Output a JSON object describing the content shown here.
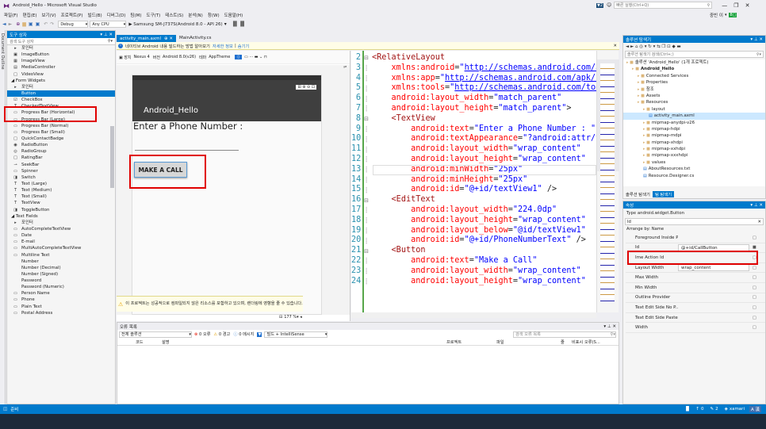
{
  "window": {
    "title": "Android_Hello - Microsoft Visual Studio",
    "quick_launch": "빠른 실행(Ctrl+Q)",
    "user": "중빈 이",
    "badge": "2"
  },
  "menu": [
    "파일(F)",
    "편집(E)",
    "보기(V)",
    "프로젝트(P)",
    "빌드(B)",
    "디버그(D)",
    "팀(M)",
    "도구(T)",
    "테스트(S)",
    "분석(N)",
    "창(W)",
    "도움말(H)"
  ],
  "toolbar": {
    "config": "Debug",
    "platform": "Any CPU",
    "device": "▶ Samsung SM-J737S(Android 8.0 - API 26)"
  },
  "toolbox": {
    "title": "도구 상자",
    "search_placeholder": "검색 도구 상자",
    "items": [
      {
        "label": "포인터",
        "icon": "▸"
      },
      {
        "label": "ImageButton",
        "icon": "▣"
      },
      {
        "label": "ImageView",
        "icon": "▦"
      },
      {
        "label": "MediaController",
        "icon": "▤"
      },
      {
        "label": "VideoView",
        "icon": "□"
      },
      {
        "label": "◢ Form Widgets",
        "icon": "",
        "group": true
      },
      {
        "label": "포인터",
        "icon": "▸"
      },
      {
        "label": "Button",
        "icon": "",
        "selected": true
      },
      {
        "label": "CheckBox",
        "icon": "☑"
      },
      {
        "label": "CheckedTextView",
        "icon": "T"
      },
      {
        "label": "Progress Bar (Horizontal)",
        "icon": "▭"
      },
      {
        "label": "Progress Bar (Large)",
        "icon": "▭"
      },
      {
        "label": "Progress Bar (Normal)",
        "icon": "▭"
      },
      {
        "label": "Progress Bar (Small)",
        "icon": "▭"
      },
      {
        "label": "QuickContactBadge",
        "icon": "□"
      },
      {
        "label": "RadioButton",
        "icon": "◉"
      },
      {
        "label": "RadioGroup",
        "icon": "◎"
      },
      {
        "label": "RatingBar",
        "icon": "□"
      },
      {
        "label": "SeekBar",
        "icon": "⊸"
      },
      {
        "label": "Spinner",
        "icon": "▭"
      },
      {
        "label": "Switch",
        "icon": "◨"
      },
      {
        "label": "Text (Large)",
        "icon": "T"
      },
      {
        "label": "Text (Medium)",
        "icon": "T"
      },
      {
        "label": "Text (Small)",
        "icon": "T"
      },
      {
        "label": "TextView",
        "icon": "T"
      },
      {
        "label": "ToggleButton",
        "icon": "◨"
      },
      {
        "label": "◢ Text Fields",
        "icon": "",
        "group": true
      },
      {
        "label": "포인터",
        "icon": "▸"
      },
      {
        "label": "AutoCompleteTextView",
        "icon": "▭"
      },
      {
        "label": "Date",
        "icon": "▭"
      },
      {
        "label": "E-mail",
        "icon": "▭"
      },
      {
        "label": "MultiAutoCompleteTextView",
        "icon": "▭"
      },
      {
        "label": "Multiline Text",
        "icon": "▭"
      },
      {
        "label": "Number",
        "icon": ""
      },
      {
        "label": "Number (Decimal)",
        "icon": ""
      },
      {
        "label": "Number (Signed)",
        "icon": ""
      },
      {
        "label": "Password",
        "icon": ""
      },
      {
        "label": "Password (Numeric)",
        "icon": ""
      },
      {
        "label": "Person Name",
        "icon": "▭"
      },
      {
        "label": "Phone",
        "icon": "▭"
      },
      {
        "label": "Plain Text",
        "icon": "▭"
      },
      {
        "label": "Postal Address",
        "icon": "▭"
      }
    ]
  },
  "tabs": [
    "activity_main.axml",
    "MainActivity.cs"
  ],
  "infobar": "네이티브 Android 내용 빌드하는 방법 알아보기",
  "infobar_link1": "자세한 정보",
  "infobar_link2": "숨기기",
  "designer": {
    "device": "Nexus 4",
    "version": "Android 8.0(v26)",
    "theme": "AppTheme",
    "app_title": "Android_Hello",
    "text_view": "Enter a Phone Number :",
    "button": "MAKE A CALL",
    "zoom": "177 %",
    "warning": "이 프로젝트는 성공적으로 컴파일되지 않은 리소스를 포함하고 있으며, 렌더링에 영향을 줄 수 있습니다."
  },
  "code_lines": [
    {
      "n": "2",
      "html": "<span class='tag'>&lt;RelativeLayout</span>"
    },
    {
      "n": "3",
      "html": "    <span class='a'>xmlns:android</span>=<span class='v'>\"</span><span class='u'>http://schemas.android.com/apk</span>"
    },
    {
      "n": "4",
      "html": "    <span class='a'>xmlns:app</span>=<span class='v'>\"</span><span class='u'>http://schemas.android.com/apk/res</span>"
    },
    {
      "n": "5",
      "html": "    <span class='a'>xmlns:tools</span>=<span class='v'>\"</span><span class='u'>http://schemas.android.com/tools</span>"
    },
    {
      "n": "6",
      "html": "    <span class='a'>android:layout_width</span>=<span class='v'>\"match_parent\"</span>"
    },
    {
      "n": "7",
      "html": "    <span class='a'>android:layout_height</span>=<span class='v'>\"match_parent\"</span>&gt;"
    },
    {
      "n": "8",
      "html": "    <span class='tag'>&lt;TextView</span>"
    },
    {
      "n": "9",
      "html": "        <span class='a'>android:text</span>=<span class='v'>\"Enter a Phone Number : \"</span>"
    },
    {
      "n": "10",
      "html": "        <span class='a'>android:textAppearance</span>=<span class='v'>\"?android:attr/tex</span>"
    },
    {
      "n": "11",
      "html": "        <span class='a'>android:layout_width</span>=<span class='v'>\"wrap_content\"</span>"
    },
    {
      "n": "12",
      "html": "        <span class='a'>android:layout_height</span>=<span class='v'>\"wrap_content\"</span>"
    },
    {
      "n": "13",
      "html": "        <span class='a'>android:minWidth</span>=<span class='v'>\"25px\"</span>"
    },
    {
      "n": "14",
      "html": "        <span class='a'>android:minHeight</span>=<span class='v'>\"25px\"</span>"
    },
    {
      "n": "15",
      "html": "        <span class='a'>android:id</span>=<span class='v'>\"@+id/textView1\"</span> /&gt;"
    },
    {
      "n": "16",
      "html": "    <span class='tag'>&lt;EditText</span>"
    },
    {
      "n": "17",
      "html": "        <span class='a'>android:layout_width</span>=<span class='v'>\"224.0dp\"</span>"
    },
    {
      "n": "18",
      "html": "        <span class='a'>android:layout_height</span>=<span class='v'>\"wrap_content\"</span>"
    },
    {
      "n": "19",
      "html": "        <span class='a'>android:layout_below</span>=<span class='v'>\"@id/textView1\"</span>"
    },
    {
      "n": "20",
      "html": "        <span class='a'>android:id</span>=<span class='v'>\"@+id/PhoneNumberText\"</span> /&gt;"
    },
    {
      "n": "21",
      "html": "    <span class='tag'>&lt;Button</span>"
    },
    {
      "n": "22",
      "html": "        <span class='a'>android:text</span>=<span class='v'>\"Make a Call\"</span>"
    },
    {
      "n": "23",
      "html": "        <span class='a'>android:layout_width</span>=<span class='v'>\"wrap_content\"</span>"
    },
    {
      "n": "24",
      "html": "        <span class='a'>android:layout_height</span>=<span class='v'>\"wrap_content\"</span>"
    }
  ],
  "errors": {
    "title": "오류 목록",
    "scope": "전체 솔루션",
    "err": "0 오류",
    "warn": "0 경고",
    "msg": "0 메시지",
    "build": "빌드 + IntelliSense",
    "search": "검색 오류 목록",
    "cols": [
      "코드",
      "설명",
      "프로젝트",
      "파일",
      "줄",
      "비표시 오류(S..."
    ]
  },
  "solution": {
    "title": "솔루션 탐색기",
    "search": "솔루션 탐색기 검색(Ctrl+;)",
    "items": [
      {
        "label": "솔루션 'Android_Hello' (1개 프로젝트)",
        "indent": 0
      },
      {
        "label": "Android_Hello",
        "indent": 1,
        "bold": true
      },
      {
        "label": "Connected Services",
        "indent": 2
      },
      {
        "label": "Properties",
        "indent": 2
      },
      {
        "label": "참조",
        "indent": 2
      },
      {
        "label": "Assets",
        "indent": 2
      },
      {
        "label": "Resources",
        "indent": 2
      },
      {
        "label": "layout",
        "indent": 3
      },
      {
        "label": "activity_main.axml",
        "indent": 4,
        "selected": true
      },
      {
        "label": "mipmap-anydpi-v26",
        "indent": 3
      },
      {
        "label": "mipmap-hdpi",
        "indent": 3
      },
      {
        "label": "mipmap-mdpi",
        "indent": 3
      },
      {
        "label": "mipmap-xhdpi",
        "indent": 3
      },
      {
        "label": "mipmap-xxhdpi",
        "indent": 3
      },
      {
        "label": "mipmap-xxxhdpi",
        "indent": 3
      },
      {
        "label": "values",
        "indent": 3
      },
      {
        "label": "AboutResources.txt",
        "indent": 3
      },
      {
        "label": "Resource.Designer.cs",
        "indent": 3
      }
    ],
    "tab1": "솔루션 탐색기",
    "tab2": "팀 탐색기"
  },
  "properties": {
    "title": "속성",
    "type": "Type  android.widget.Button",
    "search": "Id",
    "arrange": "Arrange by: Name",
    "rows": [
      {
        "name": "Foreground Inside P...",
        "value": ""
      },
      {
        "name": "Id",
        "value": "@+id/CallButton",
        "highlight": true
      },
      {
        "name": "Ime Action Id",
        "value": ""
      },
      {
        "name": "Layout Width",
        "value": "wrap_content"
      },
      {
        "name": "Max Width",
        "value": ""
      },
      {
        "name": "Min Width",
        "value": ""
      },
      {
        "name": "Outline Provider",
        "value": ""
      },
      {
        "name": "Text Edit Side No P...",
        "value": ""
      },
      {
        "name": "Text Edit Side Paste...",
        "value": ""
      },
      {
        "name": "Width",
        "value": ""
      }
    ]
  },
  "status": {
    "left": "준비",
    "up": "0",
    "edit": "2",
    "branch": "xamari",
    "lang": "A 漢"
  }
}
